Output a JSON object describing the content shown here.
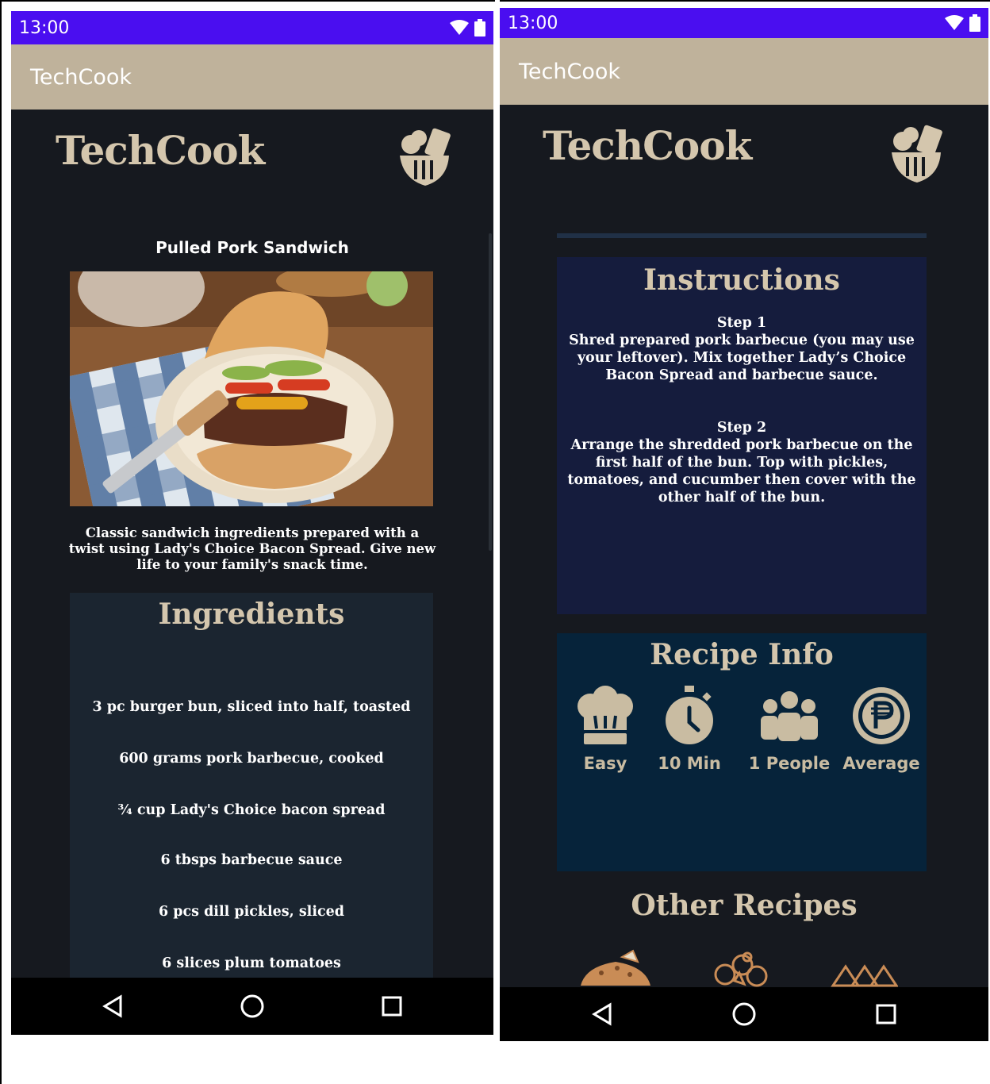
{
  "status_bar": {
    "time": "13:00"
  },
  "app_bar": {
    "title": "TechCook"
  },
  "brand": {
    "name": "TechCook",
    "tagline": ""
  },
  "left_screen": {
    "dish_title": "Pulled Pork Sandwich",
    "description": "Classic sandwich ingredients prepared with a twist using Lady's Choice Bacon Spread. Give new life to your family's snack time.",
    "ingredients_heading": "Ingredients",
    "ingredients": [
      "3 pc burger bun, sliced into half, toasted",
      "600 grams pork barbecue, cooked",
      "¾ cup Lady's Choice bacon spread",
      "6 tbsps barbecue sauce",
      "6 pcs dill pickles, sliced",
      "6 slices plum tomatoes"
    ]
  },
  "right_screen": {
    "instructions_heading": "Instructions",
    "steps": [
      {
        "label": "Step 1",
        "text": "Shred prepared pork barbecue (you may use your leftover). Mix together Lady’s Choice Bacon Spread and barbecue sauce."
      },
      {
        "label": "Step 2",
        "text": "Arrange the shredded pork barbecue on the first half of the bun. Top with pickles, tomatoes, and cucumber then cover with the other half of the bun."
      }
    ],
    "recipe_info_heading": "Recipe Info",
    "recipe_info": {
      "difficulty": "Easy",
      "time": "10 Min",
      "servings": "1 People",
      "cost": "Average"
    },
    "other_recipes_heading": "Other Recipes"
  },
  "colors": {
    "status_bar": "#4a0ef0",
    "app_bar": "#bfb29b",
    "background": "#16191f",
    "accent_text": "#d4c6ad",
    "ingredients_panel": "#1b2530",
    "instructions_panel": "#151c3d",
    "info_panel": "#06233a"
  }
}
